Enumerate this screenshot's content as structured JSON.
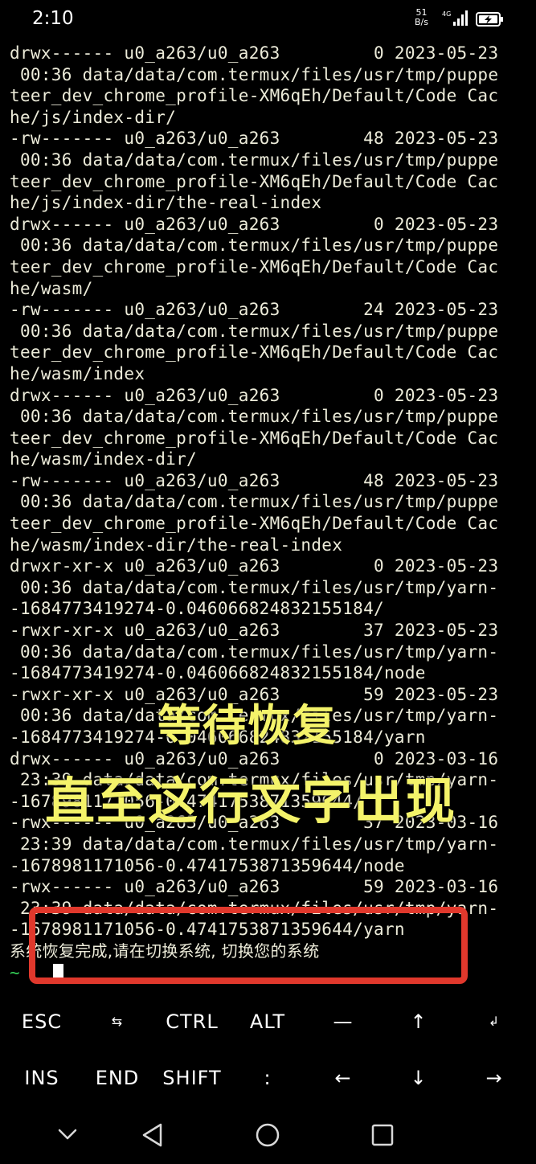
{
  "status_bar": {
    "time": "2:10",
    "net_speed_value": "51",
    "net_speed_unit": "B/s",
    "network_type": "4G",
    "signal_icon": "signal-bars-icon",
    "battery_icon": "battery-charging-icon"
  },
  "terminal": {
    "lines": [
      "drwx------ u0_a263/u0_a263         0 2023-05-23",
      " 00:36 data/data/com.termux/files/usr/tmp/puppe",
      "teer_dev_chrome_profile-XM6qEh/Default/Code Cac",
      "he/js/index-dir/",
      "-rw------- u0_a263/u0_a263        48 2023-05-23",
      " 00:36 data/data/com.termux/files/usr/tmp/puppe",
      "teer_dev_chrome_profile-XM6qEh/Default/Code Cac",
      "he/js/index-dir/the-real-index",
      "drwx------ u0_a263/u0_a263         0 2023-05-23",
      " 00:36 data/data/com.termux/files/usr/tmp/puppe",
      "teer_dev_chrome_profile-XM6qEh/Default/Code Cac",
      "he/wasm/",
      "-rw------- u0_a263/u0_a263        24 2023-05-23",
      " 00:36 data/data/com.termux/files/usr/tmp/puppe",
      "teer_dev_chrome_profile-XM6qEh/Default/Code Cac",
      "he/wasm/index",
      "drwx------ u0_a263/u0_a263         0 2023-05-23",
      " 00:36 data/data/com.termux/files/usr/tmp/puppe",
      "teer_dev_chrome_profile-XM6qEh/Default/Code Cac",
      "he/wasm/index-dir/",
      "-rw------- u0_a263/u0_a263        48 2023-05-23",
      " 00:36 data/data/com.termux/files/usr/tmp/puppe",
      "teer_dev_chrome_profile-XM6qEh/Default/Code Cac",
      "he/wasm/index-dir/the-real-index",
      "drwxr-xr-x u0_a263/u0_a263         0 2023-05-23",
      " 00:36 data/data/com.termux/files/usr/tmp/yarn-",
      "-1684773419274-0.046066824832155184/",
      "-rwxr-xr-x u0_a263/u0_a263        37 2023-05-23",
      " 00:36 data/data/com.termux/files/usr/tmp/yarn-",
      "-1684773419274-0.046066824832155184/node",
      "-rwxr-xr-x u0_a263/u0_a263        59 2023-05-23",
      " 00:36 data/data/com.termux/files/usr/tmp/yarn-",
      "-1684773419274-0.046066824832155184/yarn",
      "drwx------ u0_a263/u0_a263         0 2023-03-16",
      " 23:39 data/data/com.termux/files/usr/tmp/yarn-",
      "-1678981171056-0.4741753871359644/",
      "-rwx------ u0_a263/u0_a263        37 2023-03-16",
      " 23:39 data/data/com.termux/files/usr/tmp/yarn-",
      "-1678981171056-0.4741753871359644/node",
      "-rwx------ u0_a263/u0_a263        59 2023-03-16",
      " 23:39 data/data/com.termux/files/usr/tmp/yarn-",
      "-1678981171056-0.4741753871359644/yarn"
    ],
    "completion_message": "系统恢复完成,请在切换系统, 切换您的系统",
    "prompt": "~"
  },
  "overlay": {
    "line1": "等待恢复",
    "line2": "直至这行文字出现",
    "text_color": "#f4f36a",
    "box_color": "#e0382c"
  },
  "extra_keys": {
    "row1": [
      {
        "label": "ESC",
        "name": "esc-key"
      },
      {
        "label": "⇆",
        "name": "tab-key"
      },
      {
        "label": "CTRL",
        "name": "ctrl-key"
      },
      {
        "label": "ALT",
        "name": "alt-key"
      },
      {
        "label": "—",
        "name": "dash-key"
      },
      {
        "label": "↑",
        "name": "arrow-up-key"
      },
      {
        "label": "↲",
        "name": "enter-key"
      }
    ],
    "row2": [
      {
        "label": "INS",
        "name": "ins-key"
      },
      {
        "label": "END",
        "name": "end-key"
      },
      {
        "label": "SHIFT",
        "name": "shift-key"
      },
      {
        "label": ":",
        "name": "colon-key"
      },
      {
        "label": "←",
        "name": "arrow-left-key"
      },
      {
        "label": "↓",
        "name": "arrow-down-key"
      },
      {
        "label": "→",
        "name": "arrow-right-key"
      }
    ]
  },
  "nav_bar": {
    "icons": [
      "hide-keyboard-icon",
      "back-icon",
      "home-icon",
      "recents-icon"
    ]
  }
}
